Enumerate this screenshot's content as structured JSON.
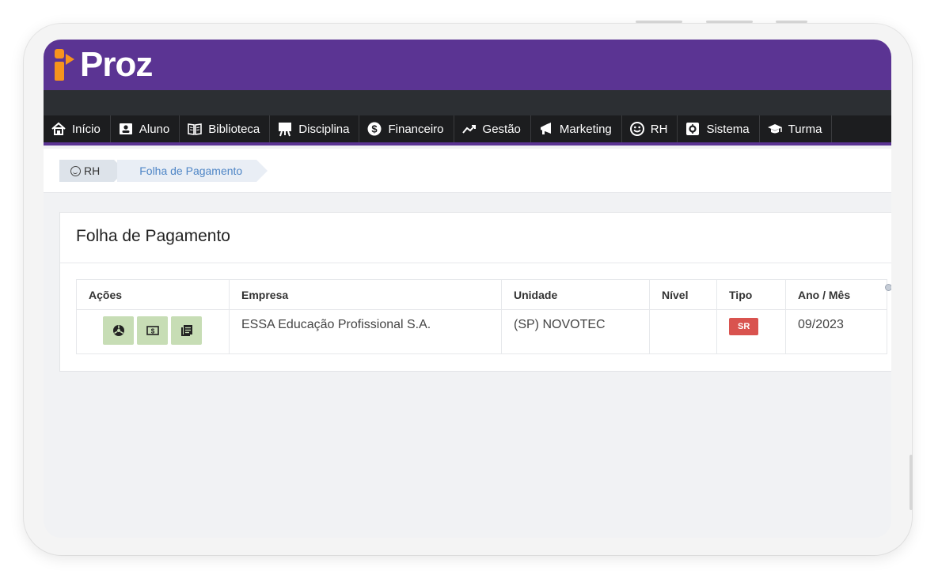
{
  "app": {
    "logo_text": "Proz",
    "brand_color": "#5b3493",
    "accent_color": "#f7941d"
  },
  "nav": [
    {
      "label": "Início",
      "icon": "home-icon"
    },
    {
      "label": "Aluno",
      "icon": "id-card-icon"
    },
    {
      "label": "Biblioteca",
      "icon": "open-book-icon"
    },
    {
      "label": "Disciplina",
      "icon": "easel-icon"
    },
    {
      "label": "Financeiro",
      "icon": "dollar-circle-icon"
    },
    {
      "label": "Gestão",
      "icon": "trending-up-icon"
    },
    {
      "label": "Marketing",
      "icon": "megaphone-icon"
    },
    {
      "label": "RH",
      "icon": "smiley-icon"
    },
    {
      "label": "Sistema",
      "icon": "gear-box-icon"
    },
    {
      "label": "Turma",
      "icon": "graduation-cap-icon"
    }
  ],
  "breadcrumb": {
    "root": "RH",
    "current": "Folha de Pagamento"
  },
  "panel": {
    "title": "Folha de Pagamento"
  },
  "table": {
    "headers": [
      "Ações",
      "Empresa",
      "Unidade",
      "Nível",
      "Tipo",
      "Ano / Mês"
    ],
    "rows": [
      {
        "actions": [
          "biohazard-icon",
          "money-icon",
          "documents-icon"
        ],
        "empresa": "ESSA Educação Profissional S.A.",
        "unidade": "(SP) NOVOTEC",
        "nivel": "",
        "tipo": "SR",
        "ano_mes": "09/2023"
      }
    ]
  }
}
